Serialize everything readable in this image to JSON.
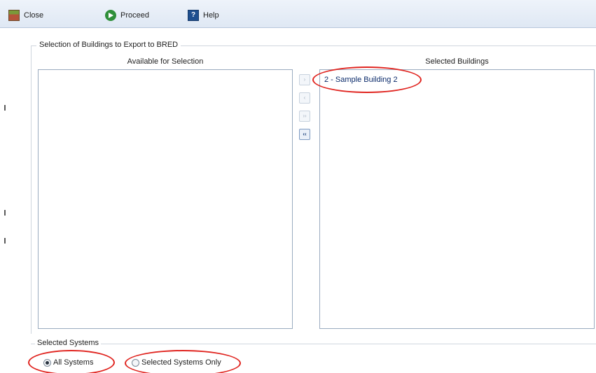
{
  "toolbar": {
    "close": {
      "label": "Close",
      "icon": "close-icon"
    },
    "proceed": {
      "label": "Proceed",
      "icon": "proceed-icon"
    },
    "help": {
      "label": "Help",
      "icon": "help-icon"
    }
  },
  "selection_group": {
    "title": "Selection of Buildings to Export to BRED",
    "available": {
      "header": "Available for Selection",
      "items": []
    },
    "selected": {
      "header": "Selected Buildings",
      "items": [
        "2 - Sample Building 2"
      ]
    },
    "move_buttons": [
      {
        "label": "›",
        "icon": "move-right-icon",
        "enabled": false
      },
      {
        "label": "‹",
        "icon": "move-left-icon",
        "enabled": false
      },
      {
        "label": "››",
        "icon": "move-all-right-icon",
        "enabled": false
      },
      {
        "label": "‹‹",
        "icon": "move-all-left-icon",
        "enabled": true
      }
    ]
  },
  "systems_group": {
    "title": "Selected Systems",
    "options": [
      {
        "label": "All Systems",
        "checked": true
      },
      {
        "label": "Selected Systems Only",
        "checked": false
      }
    ]
  },
  "colors": {
    "highlight": "#e0241f",
    "toolbar_bg": "#dfe8f4",
    "item_text": "#0a2a6a"
  }
}
